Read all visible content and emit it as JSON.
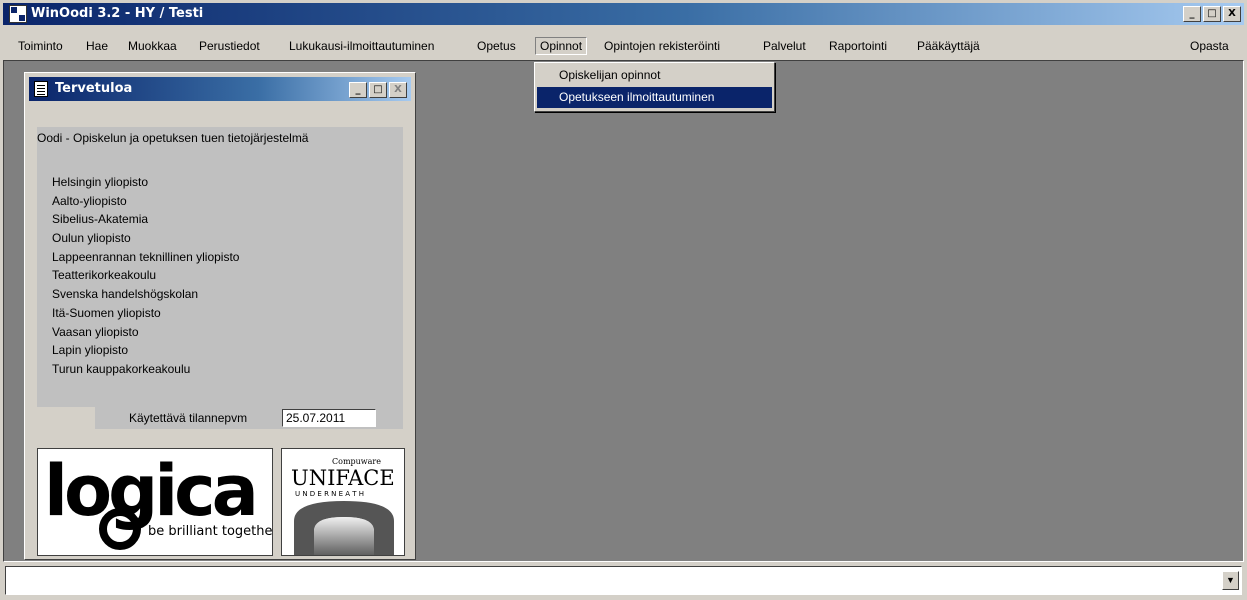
{
  "window": {
    "title": "WinOodi 3.2  -  HY / Testi",
    "minimize": "_",
    "maximize": "□",
    "close": "X"
  },
  "menubar": {
    "items": [
      "Toiminto",
      "Hae",
      "Muokkaa",
      "Perustiedot",
      "Lukukausi-ilmoittautuminen",
      "Opetus",
      "Opinnot",
      "Opintojen rekisteröinti",
      "Palvelut",
      "Raportointi",
      "Pääkäyttäjä"
    ],
    "active": "Opinnot",
    "help": "Opasta"
  },
  "dropdown": {
    "items": [
      "Opiskelijan opinnot",
      "Opetukseen ilmoittautuminen"
    ],
    "highlighted": "Opetukseen ilmoittautuminen"
  },
  "welcome": {
    "title": "Tervetuloa",
    "heading": "Oodi - Opiskelun ja opetuksen tuen tietojärjestelmä",
    "universities": [
      "Helsingin yliopisto",
      "Aalto-yliopisto",
      "Sibelius-Akatemia",
      "Oulun yliopisto",
      "Lappeenrannan teknillinen yliopisto",
      "Teatterikorkeakoulu",
      "Svenska handelshögskolan",
      "Itä-Suomen yliopisto",
      "Vaasan yliopisto",
      "Lapin yliopisto",
      "Turun kauppakorkeakoulu"
    ],
    "date_label": "Käytettävä tilannepvm",
    "date_value": "25.07.2011"
  },
  "logos": {
    "logica_word": "logica",
    "logica_tagline": "be brilliant together",
    "compuware": "Compuware",
    "uniface": "UNIFACE",
    "underneath": "U N D E R N E A T H"
  },
  "statusbar": {
    "value": "",
    "dropdown_icon": "▼"
  },
  "colors": {
    "titlebar_dark": "#0a246a",
    "titlebar_light": "#a6caf0",
    "mdi_background": "#808080",
    "face": "#d4d0c8"
  }
}
